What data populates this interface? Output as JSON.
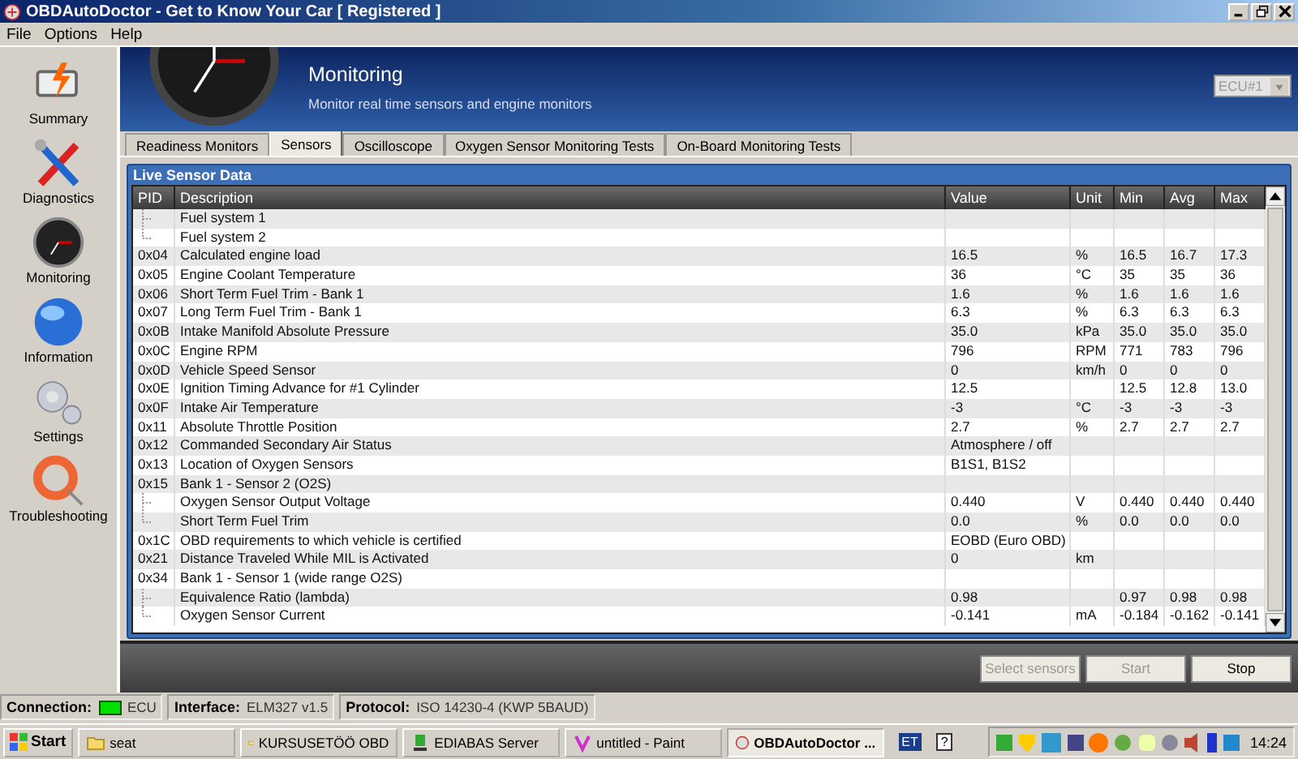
{
  "window": {
    "title": "OBDAutoDoctor - Get to Know Your Car [ Registered ]"
  },
  "menu": [
    "File",
    "Options",
    "Help"
  ],
  "sidebar": {
    "items": [
      {
        "label": "Summary",
        "kind": "engine"
      },
      {
        "label": "Diagnostics",
        "kind": "tools"
      },
      {
        "label": "Monitoring",
        "kind": "gauge"
      },
      {
        "label": "Information",
        "kind": "globe"
      },
      {
        "label": "Settings",
        "kind": "gears"
      },
      {
        "label": "Troubleshooting",
        "kind": "lifebuoy"
      }
    ]
  },
  "header": {
    "title": "Monitoring",
    "subtitle": "Monitor real time sensors and engine monitors",
    "ecu_select": "ECU#1"
  },
  "tabs": [
    {
      "label": "Readiness Monitors",
      "selected": false
    },
    {
      "label": "Sensors",
      "selected": true
    },
    {
      "label": "Oscilloscope",
      "selected": false
    },
    {
      "label": "Oxygen Sensor Monitoring Tests",
      "selected": false
    },
    {
      "label": "On-Board Monitoring Tests",
      "selected": false
    }
  ],
  "panel": {
    "title": "Live Sensor Data"
  },
  "table": {
    "columns": [
      "PID",
      "Description",
      "Value",
      "Unit",
      "Min",
      "Avg",
      "Max"
    ],
    "rows": [
      {
        "children": [
          {
            "description": "Fuel system 1"
          },
          {
            "description": "Fuel system 2"
          }
        ]
      },
      {
        "pid": "0x04",
        "description": "Calculated engine load",
        "value": "16.5",
        "unit": "%",
        "min": "16.5",
        "avg": "16.7",
        "max": "17.3"
      },
      {
        "pid": "0x05",
        "description": "Engine Coolant Temperature",
        "value": "36",
        "unit": "°C",
        "min": "35",
        "avg": "35",
        "max": "36"
      },
      {
        "pid": "0x06",
        "description": "Short Term Fuel Trim - Bank 1",
        "value": "1.6",
        "unit": "%",
        "min": "1.6",
        "avg": "1.6",
        "max": "1.6"
      },
      {
        "pid": "0x07",
        "description": "Long Term Fuel Trim - Bank 1",
        "value": "6.3",
        "unit": "%",
        "min": "6.3",
        "avg": "6.3",
        "max": "6.3"
      },
      {
        "pid": "0x0B",
        "description": "Intake Manifold Absolute Pressure",
        "value": "35.0",
        "unit": "kPa",
        "min": "35.0",
        "avg": "35.0",
        "max": "35.0"
      },
      {
        "pid": "0x0C",
        "description": "Engine RPM",
        "value": "796",
        "unit": "RPM",
        "min": "771",
        "avg": "783",
        "max": "796"
      },
      {
        "pid": "0x0D",
        "description": "Vehicle Speed Sensor",
        "value": "0",
        "unit": "km/h",
        "min": "0",
        "avg": "0",
        "max": "0"
      },
      {
        "pid": "0x0E",
        "description": "Ignition Timing Advance for #1 Cylinder",
        "value": "12.5",
        "min": "12.5",
        "avg": "12.8",
        "max": "13.0"
      },
      {
        "pid": "0x0F",
        "description": "Intake Air Temperature",
        "value": "-3",
        "unit": "°C",
        "min": "-3",
        "avg": "-3",
        "max": "-3"
      },
      {
        "pid": "0x11",
        "description": "Absolute Throttle Position",
        "value": "2.7",
        "unit": "%",
        "min": "2.7",
        "avg": "2.7",
        "max": "2.7"
      },
      {
        "pid": "0x12",
        "description": "Commanded Secondary Air Status",
        "value": "Atmosphere / off"
      },
      {
        "pid": "0x13",
        "description": "Location of Oxygen Sensors",
        "value": "B1S1, B1S2"
      },
      {
        "pid": "0x15",
        "description": "Bank 1 - Sensor 2 (O2S)",
        "children": [
          {
            "description": "Oxygen Sensor Output Voltage",
            "value": "0.440",
            "unit": "V",
            "min": "0.440",
            "avg": "0.440",
            "max": "0.440"
          },
          {
            "description": "Short Term Fuel Trim",
            "value": "0.0",
            "unit": "%",
            "min": "0.0",
            "avg": "0.0",
            "max": "0.0"
          }
        ]
      },
      {
        "pid": "0x1C",
        "description": "OBD requirements to which vehicle is certified",
        "value": "EOBD (Euro OBD)"
      },
      {
        "pid": "0x21",
        "description": "Distance Traveled While MIL is Activated",
        "value": "0",
        "unit": "km"
      },
      {
        "pid": "0x34",
        "description": "Bank 1 - Sensor 1 (wide range O2S)",
        "children": [
          {
            "description": "Equivalence Ratio (lambda)",
            "value": "0.98",
            "min": "0.97",
            "avg": "0.98",
            "max": "0.98"
          },
          {
            "description": "Oxygen Sensor Current",
            "value": "-0.141",
            "unit": "mA",
            "min": "-0.184",
            "avg": "-0.162",
            "max": "-0.141"
          }
        ]
      }
    ]
  },
  "buttons": [
    {
      "label": "Select sensors",
      "disabled": true
    },
    {
      "label": "Start",
      "disabled": true
    },
    {
      "label": "Stop",
      "disabled": false
    }
  ],
  "status_bar": [
    {
      "label": "Connection:",
      "value": "ECU",
      "color": "#00e000"
    },
    {
      "label": "Interface:",
      "value": "ELM327 v1.5"
    },
    {
      "label": "Protocol:",
      "value": "ISO 14230-4 (KWP 5BAUD)"
    }
  ],
  "taskbar": {
    "start": "Start",
    "tasks": [
      {
        "label": "seat",
        "kind": "folder",
        "selected": false
      },
      {
        "label": "KURSUSETÖÖ OBD",
        "kind": "folder",
        "selected": false
      },
      {
        "label": "EDIABAS Server",
        "kind": "server",
        "selected": false
      },
      {
        "label": "untitled - Paint",
        "kind": "paint",
        "selected": false
      },
      {
        "label": "OBDAutoDoctor ...",
        "kind": "app",
        "selected": true
      }
    ],
    "language": "ET",
    "help": "?",
    "clock": "14:24"
  }
}
